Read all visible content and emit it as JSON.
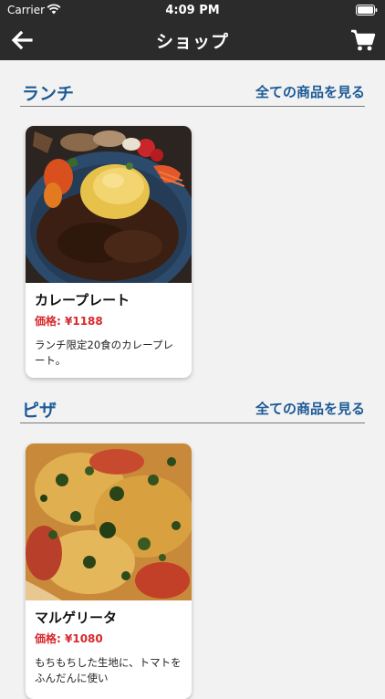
{
  "status_bar": {
    "carrier": "Carrier",
    "time": "4:09 PM"
  },
  "nav": {
    "title": "ショップ",
    "back_icon": "arrow-left-icon",
    "cart_icon": "cart-icon"
  },
  "sections": [
    {
      "title": "ランチ",
      "see_all": "全ての商品を見る",
      "products": [
        {
          "name": "カレープレート",
          "price_label": "価格:",
          "price": "¥1188",
          "description": "ランチ限定20食のカレープレート。"
        }
      ]
    },
    {
      "title": "ピザ",
      "see_all": "全ての商品を見る",
      "products": [
        {
          "name": "マルゲリータ",
          "price_label": "価格:",
          "price": "¥1080",
          "description": "もちもちした生地に、トマトをふんだんに使い"
        }
      ]
    }
  ],
  "colors": {
    "nav_background": "#2b2b2b",
    "accent_blue": "#1c5a96",
    "price_red": "#d8282c",
    "page_background": "#f2f2f2"
  }
}
